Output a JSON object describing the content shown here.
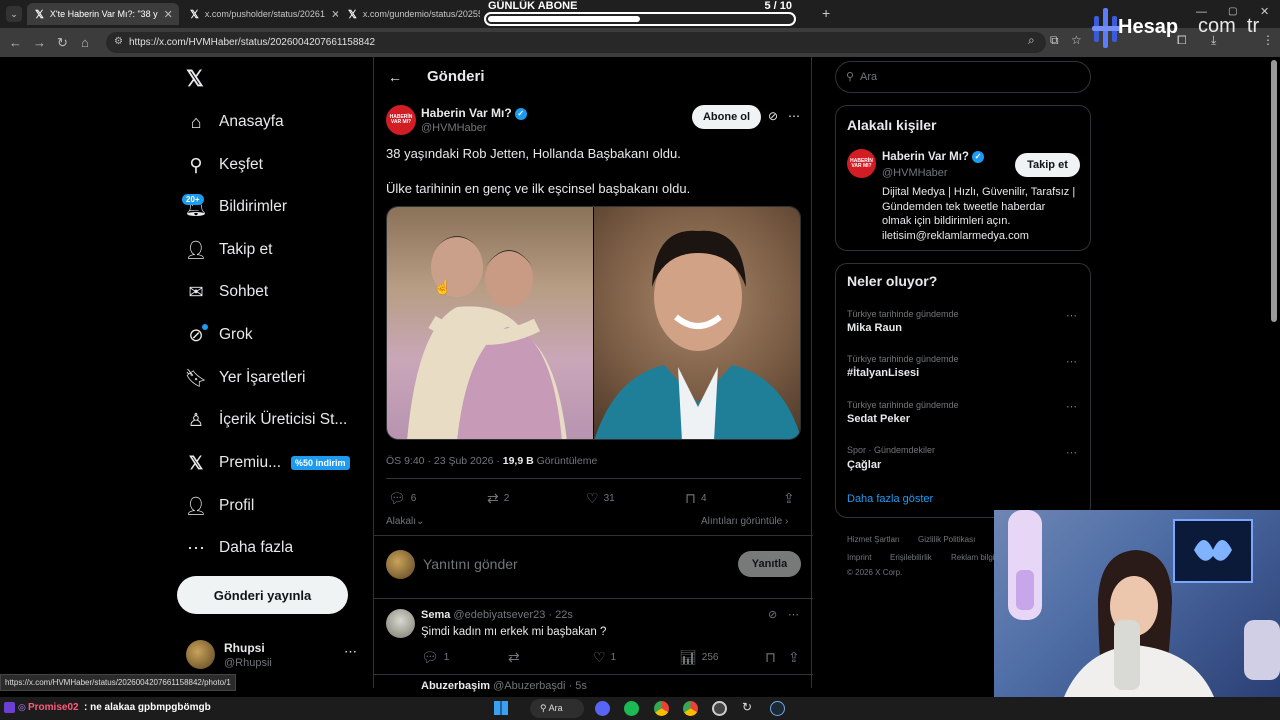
{
  "browser": {
    "tabs": [
      {
        "label": "X'te Haberin Var Mı?: \"38 y",
        "active": true
      },
      {
        "label": "x.com/pusholder/status/20261",
        "active": false
      },
      {
        "label": "x.com/gundemio/status/20255",
        "active": false
      }
    ],
    "url": "https://x.com/HVMHaber/status/2026004207661158842",
    "status_url": "https://x.com/HVMHaber/status/2026004207661158842/photo/1"
  },
  "overlay": {
    "subscriber_title": "GÜNLÜK ABONE",
    "subscriber_count": "5  / 10",
    "subscriber_progress": 0.5,
    "brand_left": "Hesap",
    "brand_right": "com  tr"
  },
  "nav": {
    "items": [
      {
        "label": "Anasayfa",
        "icon": "home-icon"
      },
      {
        "label": "Keşfet",
        "icon": "search-icon"
      },
      {
        "label": "Bildirimler",
        "icon": "bell-icon"
      },
      {
        "label": "Takip et",
        "icon": "follow-icon"
      },
      {
        "label": "Sohbet",
        "icon": "mail-icon"
      },
      {
        "label": "Grok",
        "icon": "grok-icon"
      },
      {
        "label": "Yer İşaretleri",
        "icon": "bookmark-icon"
      },
      {
        "label": "İçerik Üreticisi St...",
        "icon": "creator-icon"
      },
      {
        "label": "Premiu...",
        "icon": "x-logo-icon"
      },
      {
        "label": "Profil",
        "icon": "profile-icon"
      },
      {
        "label": "Daha fazla",
        "icon": "more-icon"
      }
    ],
    "notif_badge": "20+",
    "premium_badge": "%50 indirim",
    "post_button": "Gönderi yayınla",
    "account_name": "Rhupsi",
    "account_handle": "@Rhupsii"
  },
  "post": {
    "header_title": "Gönderi",
    "author_name": "Haberin Var Mı?",
    "author_handle": "@HVMHaber",
    "avatar_text": "HABERİN VAR MI?",
    "subscribe_label": "Abone ol",
    "text_line1": "38 yaşındaki Rob Jetten, Hollanda Başbakanı oldu.",
    "text_line2": "Ülke tarihinin en genç ve ilk eşcinsel başbakanı oldu.",
    "time": "ÖS 9:40 · 23 Şub 2026 · ",
    "views_count": "19,9 B",
    "views_label": " Görüntüleme",
    "replies": "6",
    "reposts": "2",
    "likes": "31",
    "bookmarks": "4",
    "relevant_label": "Alakalı",
    "quotes_label": "Alıntıları görüntüle",
    "reply_placeholder": "Yanıtını gönder",
    "reply_button": "Yanıtla"
  },
  "reply": {
    "name": "Sema",
    "handle": "@edebiyatsever23 · 22s",
    "text": "Şimdi kadın mı erkek mi başbakan ?",
    "replies": "1",
    "likes": "1",
    "views": "256",
    "next_name": "Abuzerbaşim",
    "next_handle": "@Abuzerbaşdi · 5s"
  },
  "sidebar": {
    "search_placeholder": "Ara",
    "related_title": "Alakalı kişiler",
    "person_name": "Haberin Var Mı?",
    "person_handle": "@HVMHaber",
    "follow_label": "Takip et",
    "bio_1": "Dijital Medya | Hızlı, Güvenilir, Tarafsız |",
    "bio_2": "Gündemden tek tweetle haberdar",
    "bio_3": "olmak için bildirimleri açın.",
    "bio_4": "iletisim@reklamlarmedya.com",
    "trends_title": "Neler oluyor?",
    "trends": [
      {
        "category": "Türkiye tarihinde gündemde",
        "title": "Mika Raun"
      },
      {
        "category": "Türkiye tarihinde gündemde",
        "title": "#İtalyanLisesi"
      },
      {
        "category": "Türkiye tarihinde gündemde",
        "title": "Sedat Peker"
      },
      {
        "category": "Spor · Gündemdekiler",
        "title": "Çağlar"
      }
    ],
    "show_more": "Daha fazla göster",
    "footer": [
      "Hizmet Şartları",
      "Gizlilik Politikası",
      "Imprint",
      "Erişilebilirlik",
      "Reklam bilgi",
      "© 2026 X Corp."
    ]
  },
  "chat": {
    "user": "Promise02",
    "message": ": ne alakaa gpbmpgbömgb"
  },
  "taskbar": {
    "search_label": "Ara"
  },
  "colors": {
    "accent": "#1d9bf0",
    "brand_red": "#d21d24"
  }
}
